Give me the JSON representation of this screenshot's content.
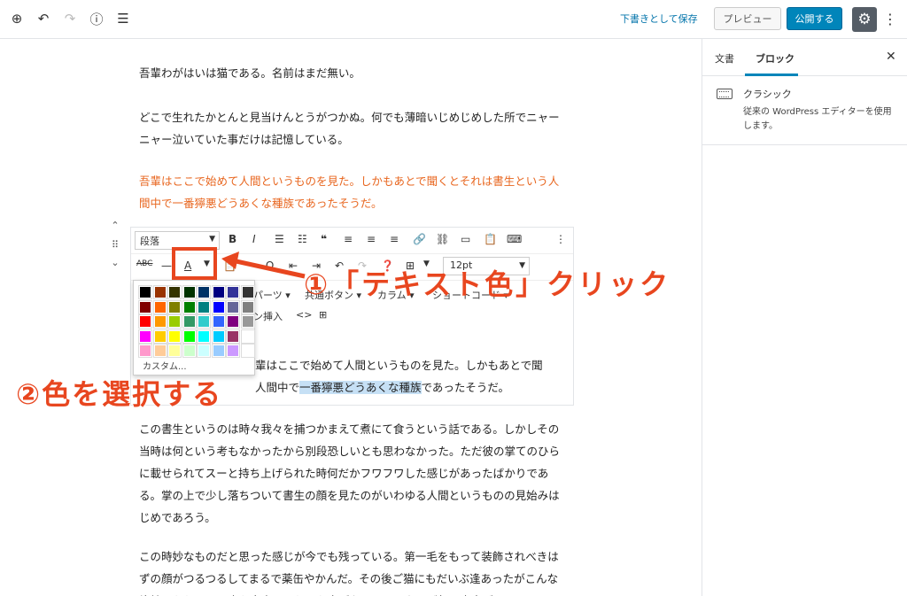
{
  "topbar": {
    "icons": [
      "add-block-icon",
      "undo-icon",
      "redo-icon",
      "info-icon",
      "outline-icon"
    ],
    "save_draft": "下書きとして保存",
    "preview": "プレビュー",
    "publish": "公開する"
  },
  "sidebar": {
    "tab_document": "文書",
    "tab_block": "ブロック",
    "block_title": "クラシック",
    "block_desc": "従来の WordPress エディターを使用します。"
  },
  "content": {
    "p1": "吾輩わがはいは猫である。名前はまだ無い。",
    "p2": "どこで生れたかとんと見当けんとうがつかぬ。何でも薄暗いじめじめした所でニャーニャー泣いていた事だけは記憶している。",
    "p3": "吾輩はここで始めて人間というものを見た。しかもあとで聞くとそれは書生という人間中で一番獰悪どうあくな種族であったそうだ。",
    "p5": "この書生というのは時々我々を捕つかまえて煮にて食うという話である。しかしその当時は何という考もなかったから別段恐しいとも思わなかった。ただ彼の掌てのひらに載せられてスーと持ち上げられた時何だかフワフワした感じがあったばかりである。掌の上で少し落ちついて書生の顔を見たのがいわゆる人間というものの見始みはじめであろう。",
    "p6": "この時妙なものだと思った感じが今でも残っている。第一毛をもって装飾されべきはずの顔がつるつるしてまるで薬缶やかんだ。その後ご猫にもだいぶ逢あったがこんな片輪かたわには一度も出会でくわした事がない。のみならず顔の真中が"
  },
  "classic": {
    "format_select": "段落",
    "font_size": "12pt",
    "menu_parts": "パーツ",
    "menu_common_button": "共通ボタン",
    "menu_column": "カラム",
    "menu_shortcode": "ショートコード",
    "menu_insert": "ン挿入",
    "text_line1": "輩はここで始めて人間というものを見た。しかもあとで聞",
    "text_line2_pre": "人間中で",
    "text_line2_hl": "一番獰悪どうあくな種族",
    "text_line2_post": "であったそうだ。"
  },
  "palette": {
    "colors": [
      [
        "#000000",
        "#993300",
        "#333300",
        "#003300",
        "#003366",
        "#000080",
        "#333399",
        "#333333"
      ],
      [
        "#800000",
        "#ff6600",
        "#808000",
        "#008000",
        "#008080",
        "#0000ff",
        "#666699",
        "#808080"
      ],
      [
        "#ff0000",
        "#ff9900",
        "#99cc00",
        "#339966",
        "#33cccc",
        "#3366ff",
        "#800080",
        "#999999"
      ],
      [
        "#ff00ff",
        "#ffcc00",
        "#ffff00",
        "#00ff00",
        "#00ffff",
        "#00ccff",
        "#993366",
        "#ffffff"
      ],
      [
        "#ff99cc",
        "#ffcc99",
        "#ffff99",
        "#ccffcc",
        "#ccffff",
        "#99ccff",
        "#cc99ff",
        "#ffffff"
      ]
    ],
    "custom": "カスタム..."
  },
  "annotations": {
    "step1": "①「テキスト色」クリック",
    "step2": "②色を選択する",
    "accent": "#e8461f"
  }
}
